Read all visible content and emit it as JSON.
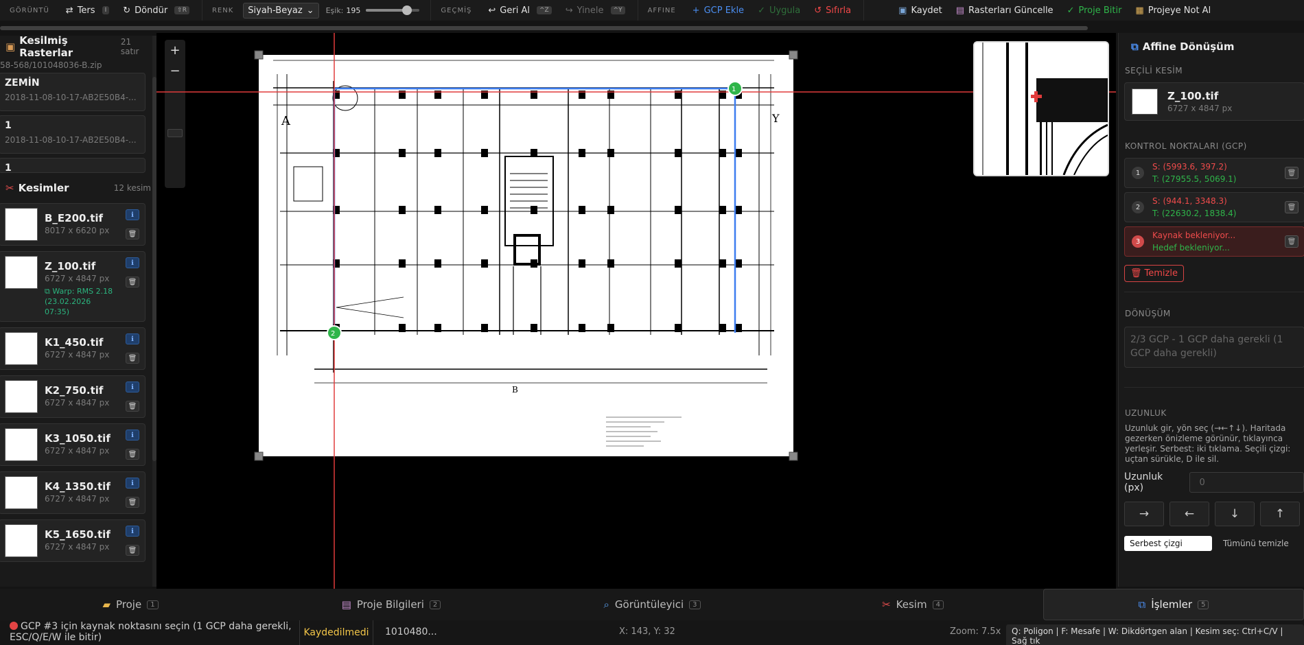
{
  "toolbar": {
    "view_label": "GÖRÜNTÜ",
    "invert_label": "Ters",
    "invert_key": "I",
    "rotate_label": "Döndür",
    "rotate_key": "⇧R",
    "color_label": "RENK",
    "color_mode": "Siyah-Beyaz",
    "threshold_label": "Eşik:",
    "threshold_value": "195",
    "threshold_fraction": 0.765,
    "history_label": "GEÇMİŞ",
    "undo_label": "Geri Al",
    "undo_key": "^Z",
    "redo_label": "Yinele",
    "redo_key": "^Y",
    "affine_label": "AFFINE",
    "add_gcp_label": "GCP Ekle",
    "apply_label": "Uygula",
    "reset_label": "Sıfırla",
    "save_label": "Kaydet",
    "update_label": "Rasterları Güncelle",
    "finish_label": "Proje Bitir",
    "note_label": "Projeye Not Al"
  },
  "left": {
    "rasters_title": "Kesilmiş Rasterlar",
    "rasters_count": "21 satır",
    "path": "58-568/101048036-B.zip",
    "rasters": [
      {
        "name": "ZEMİN",
        "sub": "2018-11-08-10-17-AB2E50B4-..."
      },
      {
        "name": "1",
        "sub": "2018-11-08-10-17-AB2E50B4-..."
      },
      {
        "name": "1",
        "sub": ""
      }
    ],
    "cuts_title": "Kesimler",
    "cuts_count": "12 kesim",
    "cuts": [
      {
        "name": "B_E200.tif",
        "size": "8017 x 6620 px",
        "warp": ""
      },
      {
        "name": "Z_100.tif",
        "size": "6727 x 4847 px",
        "warp": "Warp: RMS 2.18 (23.02.2026 07:35)"
      },
      {
        "name": "K1_450.tif",
        "size": "6727 x 4847 px",
        "warp": ""
      },
      {
        "name": "K2_750.tif",
        "size": "6727 x 4847 px",
        "warp": ""
      },
      {
        "name": "K3_1050.tif",
        "size": "6727 x 4847 px",
        "warp": ""
      },
      {
        "name": "K4_1350.tif",
        "size": "6727 x 4847 px",
        "warp": ""
      },
      {
        "name": "K5_1650.tif",
        "size": "6727 x 4847 px",
        "warp": ""
      }
    ]
  },
  "canvas": {
    "zoom_in": "+",
    "zoom_out": "−",
    "label_a": "A",
    "label_y": "Y",
    "label_b": "B",
    "gcp_marker_1": "1",
    "gcp_marker_2": "2"
  },
  "right": {
    "title": "Affine Dönüşüm",
    "selected_label": "SEÇİLİ KESİM",
    "selected_name": "Z_100.tif",
    "selected_size": "6727 x 4847 px",
    "gcp_label": "KONTROL NOKTALARI (GCP)",
    "gcps": [
      {
        "num": "1",
        "s": "S: (5993.6, 397.2)",
        "t": "T: (27955.5, 5069.1)"
      },
      {
        "num": "2",
        "s": "S: (944.1, 3348.3)",
        "t": "T: (22630.2, 1838.4)"
      },
      {
        "num": "3",
        "s": "Kaynak bekleniyor...",
        "t": "Hedef bekleniyor..."
      }
    ],
    "clear_label": "Temizle",
    "transform_label": "DÖNÜŞÜM",
    "transform_text": "2/3 GCP - 1 GCP daha gerekli (1 GCP daha gerekli)",
    "length_label": "UZUNLUK",
    "length_help": "Uzunluk gir, yön seç (→←↑↓). Haritada gezerken önizleme görünür, tıklayınca yerleşir. Serbest: iki tıklama. Seçili çizgi: uçtan sürükle, D ile sil.",
    "length_field_label": "Uzunluk (px)",
    "length_placeholder": "0",
    "dir_right": "→",
    "dir_left": "←",
    "dir_down": "↓",
    "dir_up": "↑",
    "free_line": "Serbest çizgi",
    "clear_all": "Tümünü temizle"
  },
  "tabs": [
    {
      "label": "Proje",
      "num": "1"
    },
    {
      "label": "Proje Bilgileri",
      "num": "2"
    },
    {
      "label": "Görüntüleyici",
      "num": "3"
    },
    {
      "label": "Kesim",
      "num": "4"
    },
    {
      "label": "İşlemler",
      "num": "5"
    }
  ],
  "status": {
    "message": "GCP #3 için kaynak noktasını seçin (1 GCP daha gerekli, ESC/Q/E/W ile bitir)",
    "save_state": "Kaydedilmedi",
    "project": "1010480...",
    "coords": "X: 143, Y: 32",
    "zoom": "Zoom: 7.5x",
    "shortcuts": "Q: Poligon | F: Mesafe | W: Dikdörtgen alan | Kesim seç: Ctrl+C/V | Sağ tık"
  },
  "colors": {
    "accent_blue": "#4b8ef0",
    "gcp_green": "#2fb54a",
    "error_red": "#f04848",
    "crosshair_red": "#e03b3b",
    "warn_yellow": "#f2c548"
  }
}
